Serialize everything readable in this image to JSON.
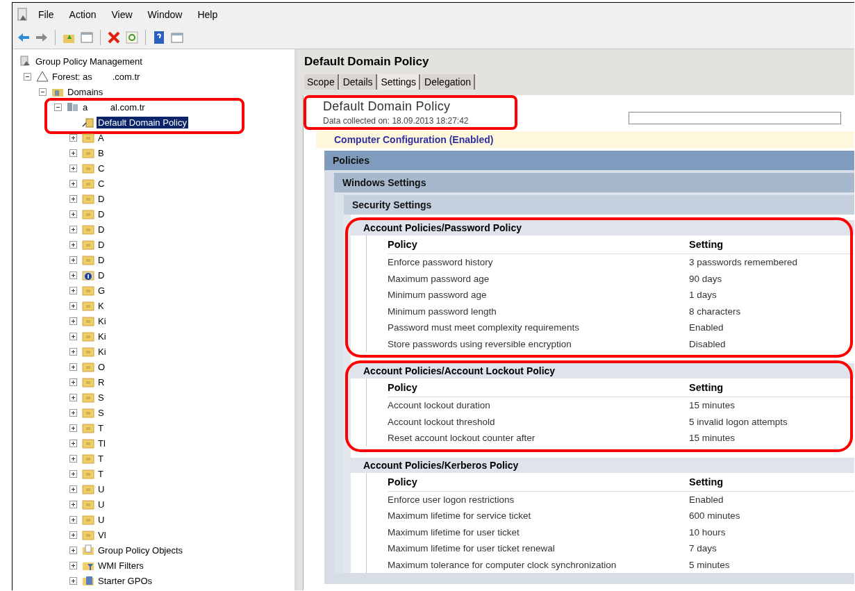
{
  "menu": [
    "File",
    "Action",
    "View",
    "Window",
    "Help"
  ],
  "toolbar": [
    {
      "kind": "back"
    },
    {
      "kind": "forward"
    },
    {
      "kind": "up"
    },
    {
      "kind": "console"
    },
    {
      "kind": "delete"
    },
    {
      "kind": "refresh"
    },
    {
      "kind": "help"
    },
    {
      "kind": "window"
    }
  ],
  "tree": [
    {
      "label": "Group Policy Management",
      "kind": "gpm",
      "selected": false,
      "children": [
        {
          "label": "Forest: as        .com.tr",
          "kind": "forest",
          "expanded": true,
          "selected": false,
          "children": [
            {
              "label": "Domains",
              "kind": "domains",
              "expanded": true,
              "selected": false,
              "children": [
                {
                  "label": "a         al.com.tr",
                  "kind": "domain",
                  "expanded": true,
                  "selected": false,
                  "highlighted": true,
                  "children": [
                    {
                      "label": "Default Domain Policy",
                      "kind": "gpo-link",
                      "selected": true
                    },
                    {
                      "label": "A",
                      "kind": "ou",
                      "expanded": false,
                      "selected": false
                    },
                    {
                      "label": "B",
                      "kind": "ou",
                      "expanded": false,
                      "selected": false
                    },
                    {
                      "label": "C",
                      "kind": "ou",
                      "expanded": false,
                      "selected": false
                    },
                    {
                      "label": "C",
                      "kind": "ou",
                      "expanded": false,
                      "selected": false
                    },
                    {
                      "label": "D",
                      "kind": "ou",
                      "expanded": false,
                      "selected": false
                    },
                    {
                      "label": "D",
                      "kind": "ou",
                      "expanded": false,
                      "selected": false
                    },
                    {
                      "label": "D",
                      "kind": "ou",
                      "expanded": false,
                      "selected": false
                    },
                    {
                      "label": "D",
                      "kind": "ou",
                      "expanded": false,
                      "selected": false
                    },
                    {
                      "label": "D",
                      "kind": "ou",
                      "expanded": false,
                      "selected": false
                    },
                    {
                      "label": "D",
                      "kind": "ou-info",
                      "expanded": false,
                      "selected": false
                    },
                    {
                      "label": "G",
                      "kind": "ou",
                      "expanded": false,
                      "selected": false
                    },
                    {
                      "label": "K",
                      "kind": "ou",
                      "expanded": false,
                      "selected": false
                    },
                    {
                      "label": "Ki",
                      "kind": "ou",
                      "expanded": false,
                      "selected": false
                    },
                    {
                      "label": "Ki",
                      "kind": "ou",
                      "expanded": false,
                      "selected": false
                    },
                    {
                      "label": "Ki",
                      "kind": "ou",
                      "expanded": false,
                      "selected": false
                    },
                    {
                      "label": "O",
                      "kind": "ou",
                      "expanded": false,
                      "selected": false
                    },
                    {
                      "label": "R",
                      "kind": "ou",
                      "expanded": false,
                      "selected": false
                    },
                    {
                      "label": "S",
                      "kind": "ou",
                      "expanded": false,
                      "selected": false
                    },
                    {
                      "label": "S",
                      "kind": "ou",
                      "expanded": false,
                      "selected": false
                    },
                    {
                      "label": "T",
                      "kind": "ou",
                      "expanded": false,
                      "selected": false
                    },
                    {
                      "label": "Tl",
                      "kind": "ou",
                      "expanded": false,
                      "selected": false
                    },
                    {
                      "label": "T",
                      "kind": "ou",
                      "expanded": false,
                      "selected": false
                    },
                    {
                      "label": "T",
                      "kind": "ou",
                      "expanded": false,
                      "selected": false
                    },
                    {
                      "label": "U",
                      "kind": "ou",
                      "expanded": false,
                      "selected": false
                    },
                    {
                      "label": "U",
                      "kind": "ou",
                      "expanded": false,
                      "selected": false
                    },
                    {
                      "label": "U",
                      "kind": "ou",
                      "expanded": false,
                      "selected": false
                    },
                    {
                      "label": "Vl",
                      "kind": "ou",
                      "expanded": false,
                      "selected": false
                    },
                    {
                      "label": "Group Policy Objects",
                      "kind": "gpo-container",
                      "expanded": false,
                      "selected": false
                    },
                    {
                      "label": "WMI Filters",
                      "kind": "wmi",
                      "expanded": false,
                      "selected": false
                    },
                    {
                      "label": "Starter GPOs",
                      "kind": "starter",
                      "expanded": false,
                      "selected": false
                    }
                  ]
                }
              ]
            }
          ]
        }
      ]
    }
  ],
  "detail": {
    "title": "Default Domain Policy",
    "tabs": [
      {
        "label": "Scope",
        "selected": false
      },
      {
        "label": "Details",
        "selected": false
      },
      {
        "label": "Settings",
        "selected": true
      },
      {
        "label": "Delegation",
        "selected": false
      }
    ],
    "report": {
      "title": "Default Domain Policy",
      "collected": "Data collected on: 18.09.2013 18:27:42",
      "highlighted": true,
      "configuration": "Computer Configuration (Enabled)",
      "headings": [
        {
          "label": "Policies",
          "children": [
            {
              "label": "Windows Settings",
              "children": [
                {
                  "label": "Security Settings"
                }
              ]
            }
          ]
        }
      ],
      "sections": [
        {
          "title": "Account Policies/Password Policy",
          "highlighted": true,
          "columns": [
            "Policy",
            "Setting"
          ],
          "rows": [
            [
              "Enforce password history",
              "3 passwords remembered"
            ],
            [
              "Maximum password age",
              "90 days"
            ],
            [
              "Minimum password age",
              "1 days"
            ],
            [
              "Minimum password length",
              "8 characters"
            ],
            [
              "Password must meet complexity requirements",
              "Enabled"
            ],
            [
              "Store passwords using reversible encryption",
              "Disabled"
            ]
          ]
        },
        {
          "title": "Account Policies/Account Lockout Policy",
          "highlighted": true,
          "columns": [
            "Policy",
            "Setting"
          ],
          "rows": [
            [
              "Account lockout duration",
              "15 minutes"
            ],
            [
              "Account lockout threshold",
              "5 invalid logon attempts"
            ],
            [
              "Reset account lockout counter after",
              "15 minutes"
            ]
          ]
        },
        {
          "title": "Account Policies/Kerberos Policy",
          "highlighted": false,
          "columns": [
            "Policy",
            "Setting"
          ],
          "rows": [
            [
              "Enforce user logon restrictions",
              "Enabled"
            ],
            [
              "Maximum lifetime for service ticket",
              "600 minutes"
            ],
            [
              "Maximum lifetime for user ticket",
              "10 hours"
            ],
            [
              "Maximum lifetime for user ticket renewal",
              "7 days"
            ],
            [
              "Maximum tolerance for computer clock synchronization",
              "5 minutes"
            ]
          ]
        }
      ]
    }
  }
}
